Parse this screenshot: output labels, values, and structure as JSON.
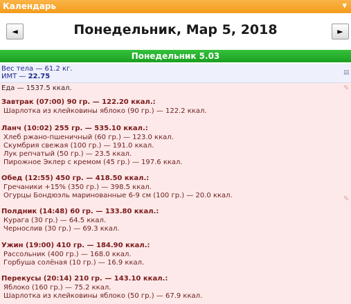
{
  "window": {
    "title": "Календарь",
    "close_glyph": "▾"
  },
  "nav": {
    "prev": "◄",
    "next": "►",
    "date": "Понедельник, Мар 5, 2018"
  },
  "day_header": "Понедельник 5.03",
  "body": {
    "weight": "Вес тела — 61.2 кг.",
    "bmi_label": "ИМТ — ",
    "bmi_value": "22.75"
  },
  "food_total": "Еда — 1537.5 ккал.",
  "meals": [
    {
      "header": "Завтрак (07:00) 90 гр. — 122.20 ккал.:",
      "items": [
        "Шарлотка из клейковины яблоко (90 гр.) — 122.2 ккал."
      ]
    },
    {
      "header": "Ланч (10:02) 255 гр. — 535.10 ккал.:",
      "items": [
        "Хлеб ржано-пшеничный (60 гр.) — 123.0 ккал.",
        "Скумбрия свежая (100 гр.) — 191.0 ккал.",
        "Лук репчатый (50 гр.) — 23.5 ккал.",
        "Пирожное Эклер с кремом (45 гр.) — 197.6 ккал."
      ]
    },
    {
      "header": "Обед (12:55) 450 гр. — 418.50 ккал.:",
      "items": [
        "Гречаники +15% (350 гр.) — 398.5 ккал.",
        "Огурцы Бондюэль маринованные 6-9 см (100 гр.) — 20.0 ккал."
      ]
    },
    {
      "header": "Полдник (14:48) 60 гр. — 133.80 ккал.:",
      "items": [
        "Курага (30 гр.) — 64.5 ккал.",
        "Чернослив (30 гр.) — 69.3 ккал."
      ]
    },
    {
      "header": "Ужин (19:00) 410 гр. — 184.90 ккал.:",
      "items": [
        "Рассольник (400 гр.) — 168.0 ккал.",
        "Горбуша солёная (10 гр.) — 16.9 ккал."
      ]
    },
    {
      "header": "Перекусы (20:14) 210 гр. — 143.10 ккал.:",
      "items": [
        "Яблоко (160 гр.) — 75.2 ккал.",
        "Шарлотка из клейковины яблоко (50 гр.) — 67.9 ккал."
      ]
    }
  ],
  "icons": {
    "edit": "pencil-icon",
    "weight": "scale-icon",
    "close": "chevron-down-icon"
  },
  "colors": {
    "title_orange": "#f5a623",
    "day_green": "#22a82a",
    "meal_bg": "#fde9e9",
    "weight_bg": "#eef0fb"
  }
}
